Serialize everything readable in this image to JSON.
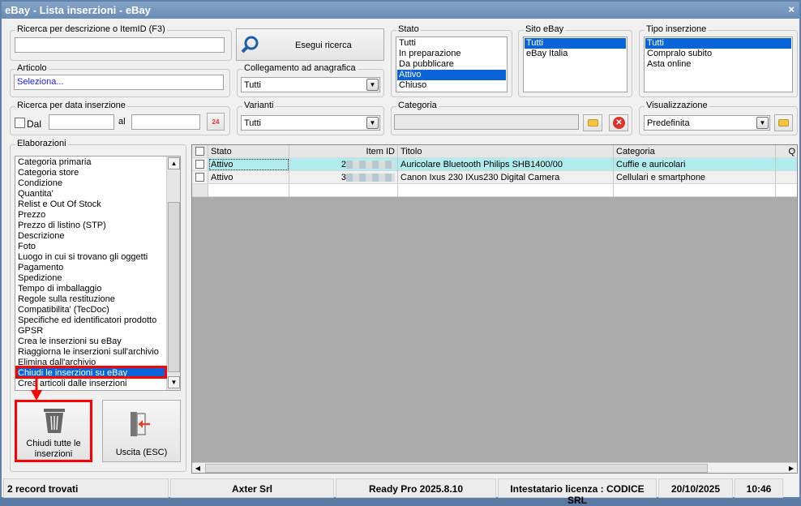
{
  "window": {
    "title": "eBay - Lista inserzioni - eBay",
    "close": "×"
  },
  "search": {
    "legend": "Ricerca per descrizione o ItemID (F3)",
    "value": "",
    "button": "Esegui ricerca"
  },
  "articolo": {
    "legend": "Articolo",
    "value": "Seleziona..."
  },
  "collegamento": {
    "legend": "Collegamento ad anagrafica",
    "value": "Tutti"
  },
  "data": {
    "legend": "Ricerca per data inserzione",
    "dal": "Dal",
    "al": "al",
    "calendar": "24"
  },
  "varianti": {
    "legend": "Varianti",
    "value": "Tutti"
  },
  "stato": {
    "legend": "Stato",
    "items": [
      "Tutti",
      "In preparazione",
      "Da pubblicare",
      "Attivo",
      "Chiuso"
    ],
    "selected": "Attivo"
  },
  "sito": {
    "legend": "Sito eBay",
    "items": [
      "Tutti",
      "eBay Italia"
    ]
  },
  "tipo": {
    "legend": "Tipo inserzione",
    "items": [
      "Tutti",
      "Compralo subito",
      "Asta online"
    ]
  },
  "categoria": {
    "legend": "Categoria",
    "value": ""
  },
  "visualizzazione": {
    "legend": "Visualizzazione",
    "value": "Predefinita"
  },
  "elaborazioni": {
    "legend": "Elaborazioni",
    "items": [
      "Categoria primaria",
      "Categoria store",
      "Condizione",
      "Quantita'",
      "Relist e Out Of Stock",
      "Prezzo",
      "Prezzo di listino (STP)",
      "Descrizione",
      "Foto",
      "Luogo in cui si trovano gli oggetti",
      "Pagamento",
      "Spedizione",
      "Tempo di imballaggio",
      "Regole sulla restituzione",
      "Compatibilita' (TecDoc)",
      "Specifiche ed identificatori prodotto",
      "GPSR",
      "Crea le inserzioni su eBay",
      "Riaggiorna le inserzioni sull'archivio",
      "Elimina dall'archivio",
      "Chiudi le inserzioni su eBay",
      "Crea articoli dalle inserzioni"
    ],
    "selected": "Chiudi le inserzioni su eBay"
  },
  "buttons": {
    "chiudi": "Chiudi tutte le inserzioni",
    "uscita": "Uscita (ESC)"
  },
  "grid": {
    "columns": [
      "Stato",
      "Item ID",
      "Titolo",
      "Categoria",
      "Q"
    ],
    "rows": [
      {
        "stato": "Attivo",
        "item_id": "2",
        "titolo": "Auricolare Bluetooth Philips SHB1400/00",
        "categoria": "Cuffie e auricolari"
      },
      {
        "stato": "Attivo",
        "item_id": "3",
        "titolo": "Canon Ixus 230 IXus230 Digital Camera",
        "categoria": "Cellulari e smartphone"
      }
    ]
  },
  "statusbar": {
    "records": "2 record trovati",
    "company": "Axter Srl",
    "version": "Ready Pro 2025.8.10",
    "license": "Intestatario licenza : CODICE SRL",
    "date": "20/10/2025",
    "time": "10:46"
  },
  "colors": {
    "selection": "#0a64d8",
    "row_highlight": "#b0ecee",
    "annotation": "#ff0000"
  }
}
